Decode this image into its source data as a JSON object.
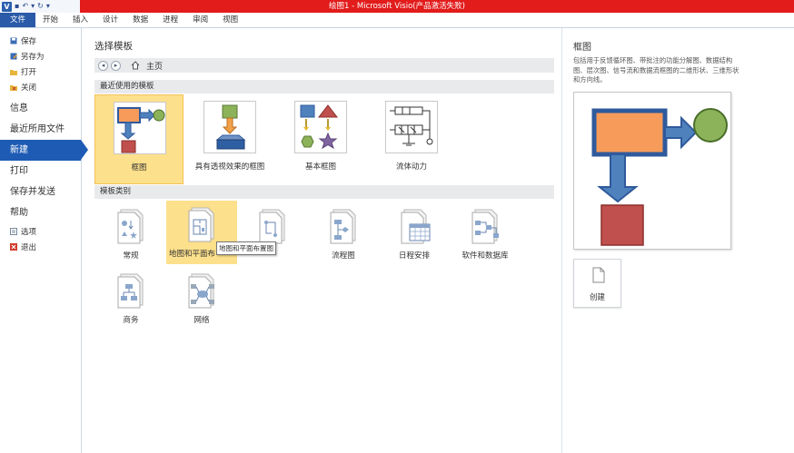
{
  "window": {
    "title": "绘图1 - Microsoft Visio(产品激活失败)",
    "app_logo": "V",
    "quick_access": [
      "save-icon",
      "undo-icon",
      "redo-icon",
      "customize-icon"
    ]
  },
  "ribbon": {
    "tabs": [
      "文件",
      "开始",
      "插入",
      "设计",
      "数据",
      "进程",
      "审阅",
      "视图"
    ]
  },
  "nav": {
    "save": "保存",
    "save_as": "另存为",
    "open": "打开",
    "close": "关闭",
    "info": "信息",
    "recent": "最近所用文件",
    "new": "新建",
    "print": "打印",
    "save_send": "保存并发送",
    "help": "帮助",
    "options": "选项",
    "exit": "退出"
  },
  "main": {
    "heading": "选择模板",
    "breadcrumb": {
      "home": "主页"
    },
    "recent_section": "最近使用的模板",
    "recent_templates": [
      {
        "label": "框图",
        "icon": "block-diagram-icon",
        "selected": true
      },
      {
        "label": "具有透视效果的框图",
        "icon": "perspective-block-icon",
        "selected": false
      },
      {
        "label": "基本框图",
        "icon": "basic-block-icon",
        "selected": false
      },
      {
        "label": "流体动力",
        "icon": "fluid-power-icon",
        "selected": false
      }
    ],
    "category_section": "模板类别",
    "categories": [
      {
        "label": "常规",
        "icon": "general-icon"
      },
      {
        "label": "地图和平面布",
        "icon": "maps-floorplans-icon",
        "selected": true
      },
      {
        "label": "",
        "icon": "engineering-icon"
      },
      {
        "label": "流程图",
        "icon": "flowchart-icon"
      },
      {
        "label": "日程安排",
        "icon": "schedule-icon"
      },
      {
        "label": "软件和数据库",
        "icon": "software-database-icon"
      },
      {
        "label": "商务",
        "icon": "business-icon"
      },
      {
        "label": "网络",
        "icon": "network-icon"
      }
    ],
    "tooltip": "地图和平面布置图"
  },
  "right_pane": {
    "title": "框图",
    "description": "包括用于反馈循环图、带批注的功能分解图、数据结构图、层次图、信号流和数据流框图的二维形状、三维形状和方向线。",
    "create_label": "创建",
    "colors": {
      "orange": "#f79b5a",
      "blue": "#4f81bd",
      "green": "#8db35a",
      "red": "#c0504d"
    }
  }
}
